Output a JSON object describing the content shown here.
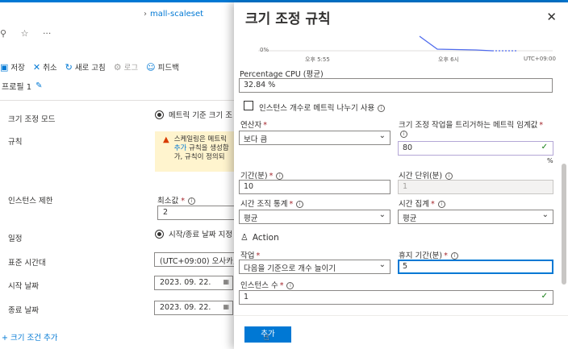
{
  "background": {
    "breadcrumb": "mall-scaleset",
    "icons": [
      "pin-icon",
      "star-icon",
      "more-icon"
    ],
    "toolbar": [
      {
        "label": "저장",
        "icon": "save-icon",
        "disabled": false
      },
      {
        "label": "취소",
        "icon": "close-icon",
        "disabled": false
      },
      {
        "label": "새로 고침",
        "icon": "refresh-icon",
        "disabled": false
      },
      {
        "label": "로그",
        "icon": "log-icon",
        "disabled": true
      },
      {
        "label": "피드백",
        "icon": "feedback-icon",
        "disabled": false
      }
    ],
    "profile": "프로필 1",
    "scale_mode_label": "크기 조정 모드",
    "scale_mode_value": "메트릭 기준 크기 조",
    "rules_label": "규칙",
    "warning_line1": "스케일링은 메트릭",
    "warning_link": "추가",
    "warning_line2": "규칙을 생성합",
    "warning_line3": "가, 규칙이 정의되",
    "instance_limit_label": "인스턴스 제한",
    "min_label": "최소값",
    "min_value": "2",
    "schedule_label": "일정",
    "schedule_value": "시작/종료 날짜 지정",
    "timezone_label": "표준 시간대",
    "timezone_value": "(UTC+09:00) 오사카, 삿",
    "start_label": "시작 날짜",
    "start_value": "2023. 09. 22.",
    "end_label": "종료 날짜",
    "end_value": "2023. 09. 22.",
    "add_condition": "+ 크기 조건 추가"
  },
  "panel": {
    "title": "크기 조정 규칙",
    "chart": {
      "y_label": "0%",
      "x_labels": [
        "오후 5:55",
        "오후 6시",
        "UTC+09:00"
      ]
    },
    "metric_label": "Percentage CPU (평균)",
    "metric_value": "32.84 %",
    "split_label": "인스턴스 개수로 메트릭 나누기 사용",
    "operator_label": "연산자",
    "operator_value": "보다 큼",
    "threshold_label": "크기 조정 작업을 트리거하는 메트릭 임계값",
    "threshold_value": "80",
    "threshold_unit": "%",
    "duration_label": "기간(분)",
    "duration_value": "10",
    "grain_label": "시간 단위(분)",
    "grain_value": "1",
    "grain_stat_label": "시간 조직 통계",
    "grain_stat_value": "평균",
    "aggregation_label": "시간 집계",
    "aggregation_value": "평균",
    "action_heading": "Action",
    "operation_label": "작업",
    "operation_value": "다음을 기준으로 개수 늘이기",
    "cooldown_label": "휴지 기간(분)",
    "cooldown_value": "5",
    "count_label": "인스턴스 수",
    "count_value": "1",
    "add_button": "추가"
  }
}
